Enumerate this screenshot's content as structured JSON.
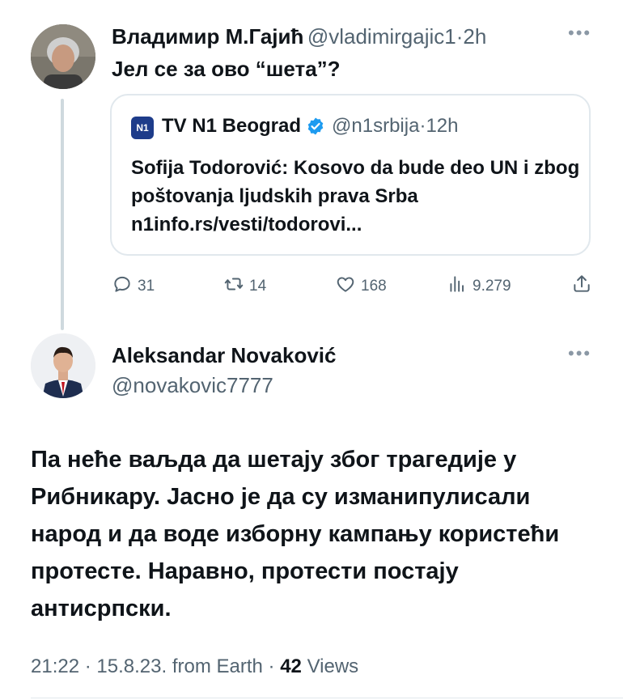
{
  "colors": {
    "text": "#0f1419",
    "muted": "#536471",
    "verified": "#1d9bf0",
    "n1_brand": "#1e3c8a"
  },
  "tweet1": {
    "name": "Владимир М.Гајић",
    "handle": "@vladimirgajic1",
    "separator": "·",
    "time": "2h",
    "more_icon": "more-icon",
    "text": "Јел се за ово “шета”?",
    "quote": {
      "logo": "N1",
      "name": "TV N1 Beograd",
      "verified_icon": "verified-badge-icon",
      "handle": "@n1srbija",
      "separator": "·",
      "time": "12h",
      "text": "Sofija Todorović: Kosovo da bude deo UN i zbog poštovanja ljudskih prava Srba n1info.rs/vesti/todorovi..."
    },
    "actions": {
      "replies": "31",
      "retweets": "14",
      "likes": "168",
      "views": "9.279"
    }
  },
  "tweet2": {
    "name": "Aleksandar Novaković",
    "handle": "@novakovic7777",
    "more_icon": "more-icon",
    "text": "Па неће ваљда да шетају због трагедије у Рибникару. Јасно је да су изманипулисали народ и да воде изборну кампању користећи протесте. Наравно, протести постају антисрпски.",
    "time": "21:22",
    "date": "15.8.23.",
    "source": "from Earth",
    "views_count": "42",
    "views_label": "Views",
    "separator": "·"
  }
}
